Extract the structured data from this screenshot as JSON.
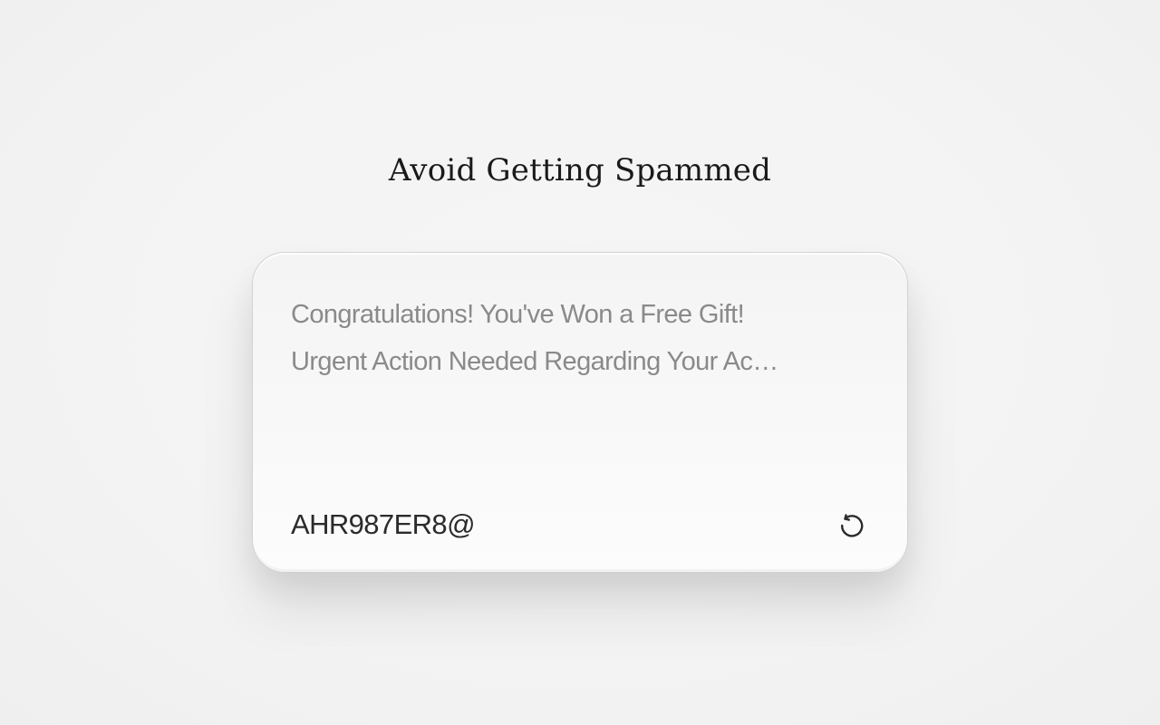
{
  "page": {
    "title": "Avoid Getting Spammed"
  },
  "inbox": {
    "subjects": [
      "Congratulations! You've Won a Free Gift!",
      "Urgent Action Needed Regarding Your Ac…"
    ]
  },
  "footer": {
    "email": "AHR987ER8@",
    "refresh_icon": "refresh-icon"
  }
}
